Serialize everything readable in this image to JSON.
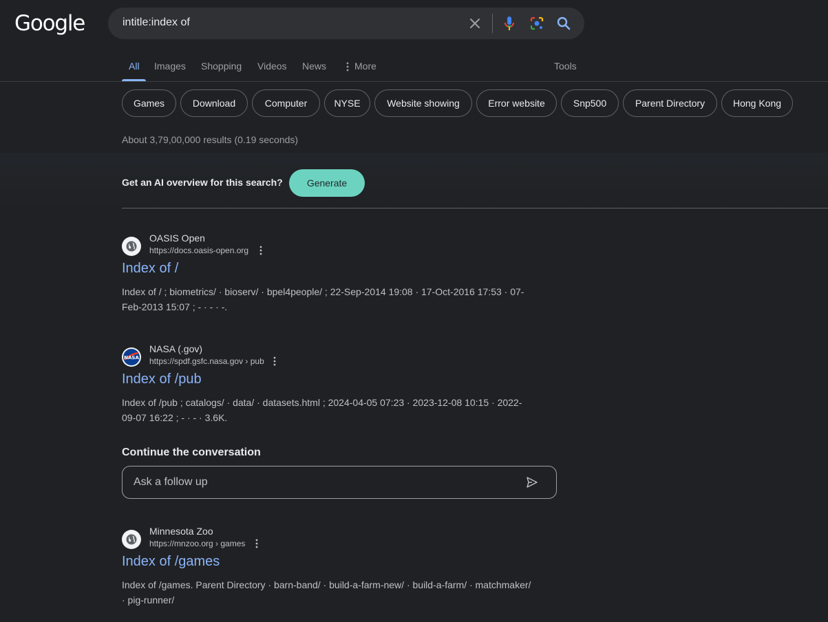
{
  "logo": "Google",
  "search": {
    "query": "intitle:index of"
  },
  "tabs": [
    {
      "label": "All",
      "active": true
    },
    {
      "label": "Images"
    },
    {
      "label": "Shopping"
    },
    {
      "label": "Videos"
    },
    {
      "label": "News"
    },
    {
      "label": "More"
    }
  ],
  "tools_label": "Tools",
  "chips": [
    "Games",
    "Download",
    "Computer",
    "NYSE",
    "Website showing",
    "Error website",
    "Snp500",
    "Parent Directory",
    "Hong Kong"
  ],
  "result_stats": "About 3,79,00,000 results (0.19 seconds)",
  "ai_overview": {
    "prompt": "Get an AI overview for this search?",
    "button": "Generate"
  },
  "results": [
    {
      "site": "OASIS Open",
      "url": "https://docs.oasis-open.org",
      "icon": "globe-icon",
      "title": "Index of /",
      "snippet": "Index of / ; biometrics/ · bioserv/ · bpel4people/ ; 22-Sep-2014 19:08 · 17-Oct-2016 17:53 · 07-Feb-2013 15:07 ; - · - · -."
    },
    {
      "site": "NASA (.gov)",
      "url": "https://spdf.gsfc.nasa.gov › pub",
      "icon": "nasa-logo-icon",
      "title": "Index of /pub",
      "snippet": "Index of /pub ; catalogs/ · data/ · datasets.html ; 2024-04-05 07:23 · 2023-12-08 10:15 · 2022-09-07 16:22 ; - · - · 3.6K."
    },
    {
      "site": "Minnesota Zoo",
      "url": "https://mnzoo.org › games",
      "icon": "globe-icon",
      "title": "Index of /games",
      "snippet": "Index of /games. Parent Directory · barn-band/ · build-a-farm-new/ · build-a-farm/ · matchmaker/ · pig-runner/"
    }
  ],
  "conversation": {
    "heading": "Continue the conversation",
    "placeholder": "Ask a follow up"
  },
  "colors": {
    "background": "#202124",
    "link": "#8ab4f8",
    "generate": "#6dd3c1"
  }
}
